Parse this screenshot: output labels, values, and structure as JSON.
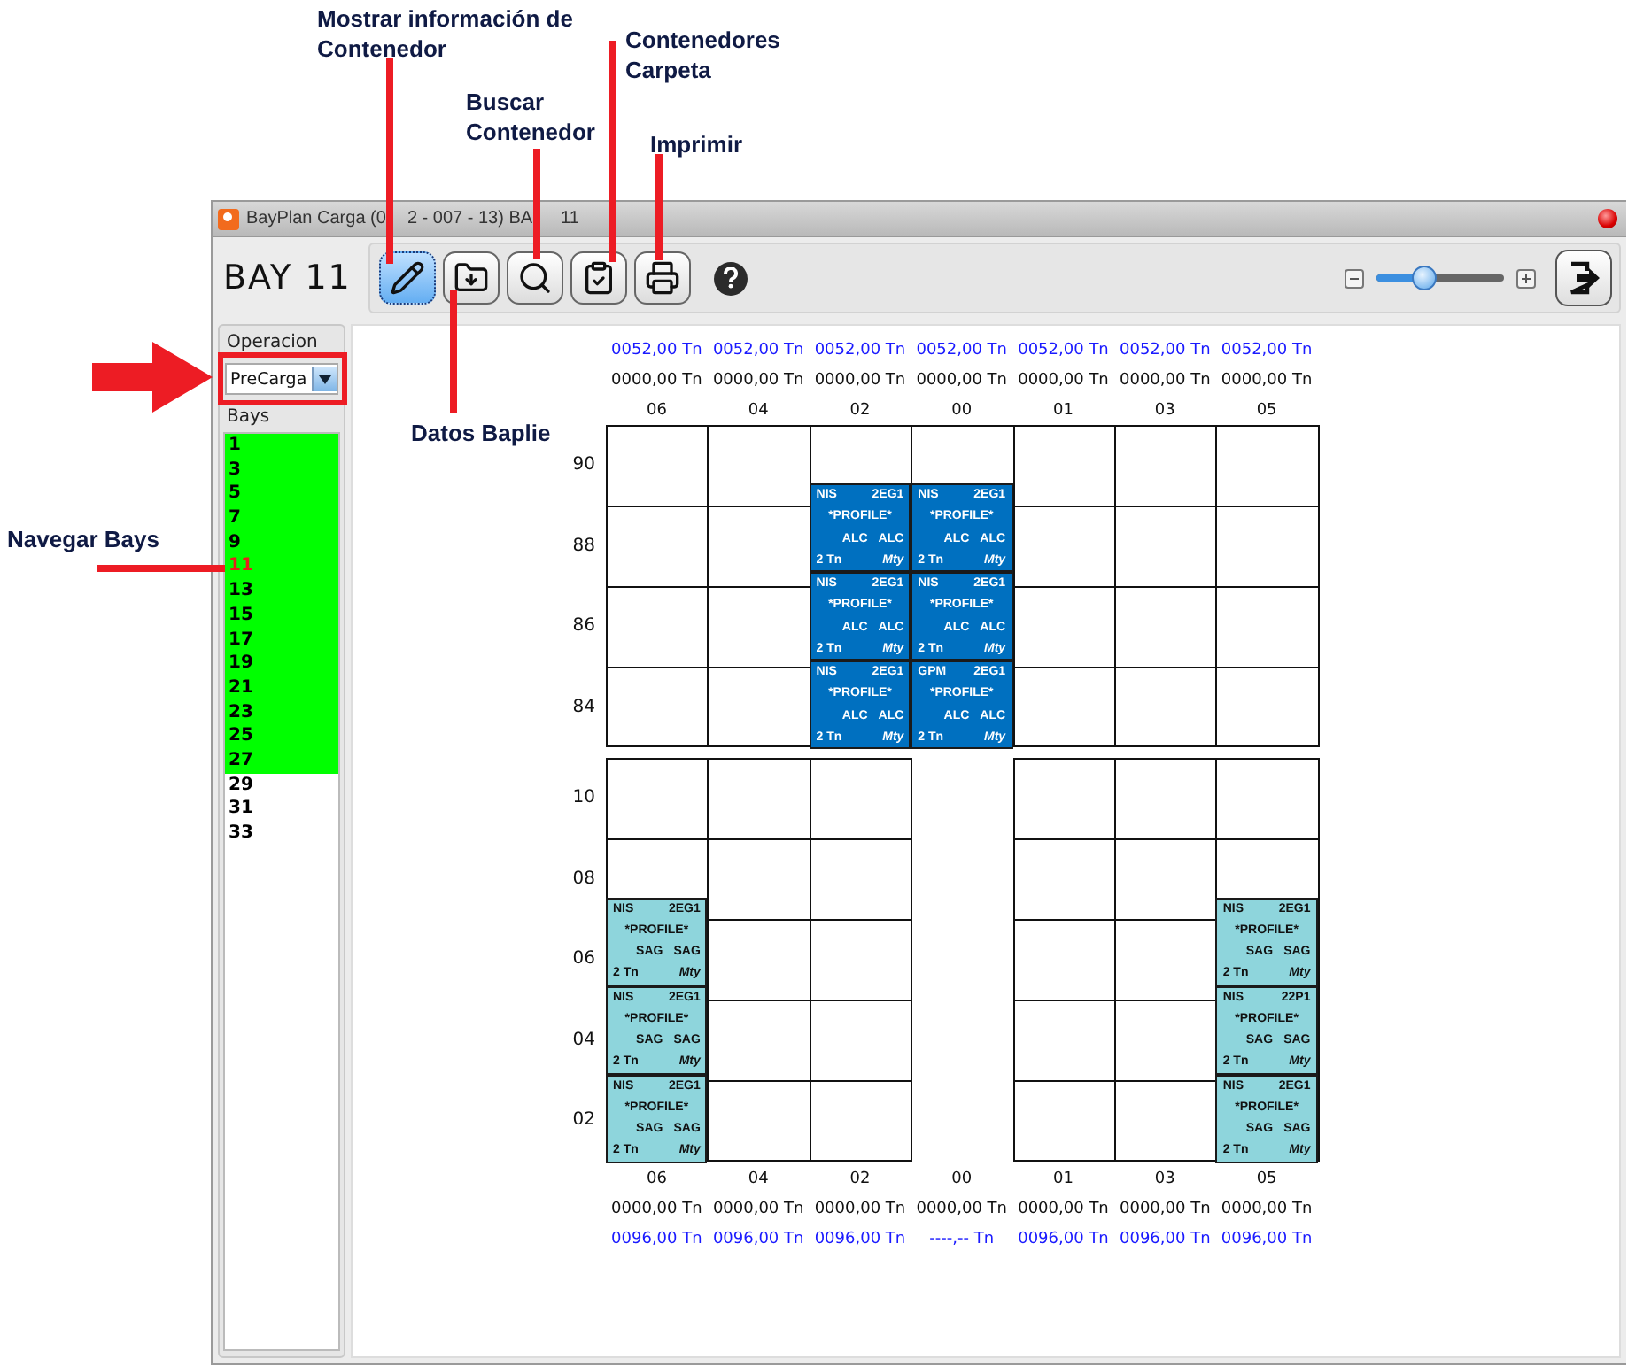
{
  "annotations": [
    {
      "text": "Mostrar información de Contenedor"
    },
    {
      "text": "Buscar Contenedor"
    },
    {
      "text": "Contenedores Carpeta"
    },
    {
      "text": "Imprimir"
    },
    {
      "text": "Datos Baplie"
    },
    {
      "text": "Navegar Bays"
    }
  ],
  "window": {
    "title_segments": [
      "BayPlan Carga (0",
      "2 - 007 - 13) BA",
      "11"
    ]
  },
  "toolbar": {
    "bay_label": "BAY 11",
    "tools": [
      {
        "kind": "pencil",
        "selected": true
      },
      {
        "kind": "download",
        "selected": false
      },
      {
        "kind": "search",
        "selected": false
      },
      {
        "kind": "clipboard",
        "selected": false
      },
      {
        "kind": "printer",
        "selected": false
      },
      {
        "kind": "help",
        "selected": false
      }
    ],
    "zoom": {
      "level": 0.38
    }
  },
  "sidebar": {
    "operation_label": "Operacion",
    "operation_value": "PreCarga",
    "bays_label": "Bays",
    "bays": [
      {
        "label": "1",
        "highlighted": true,
        "selected": false
      },
      {
        "label": "3",
        "highlighted": true,
        "selected": false
      },
      {
        "label": "5",
        "highlighted": true,
        "selected": false
      },
      {
        "label": "7",
        "highlighted": true,
        "selected": false
      },
      {
        "label": "9",
        "highlighted": true,
        "selected": false
      },
      {
        "label": "11",
        "highlighted": true,
        "selected": true
      },
      {
        "label": "13",
        "highlighted": true,
        "selected": false
      },
      {
        "label": "15",
        "highlighted": true,
        "selected": false
      },
      {
        "label": "17",
        "highlighted": true,
        "selected": false
      },
      {
        "label": "19",
        "highlighted": true,
        "selected": false
      },
      {
        "label": "21",
        "highlighted": true,
        "selected": false
      },
      {
        "label": "23",
        "highlighted": true,
        "selected": false
      },
      {
        "label": "25",
        "highlighted": true,
        "selected": false
      },
      {
        "label": "27",
        "highlighted": true,
        "selected": false
      },
      {
        "label": "29",
        "highlighted": false,
        "selected": false
      },
      {
        "label": "31",
        "highlighted": false,
        "selected": false
      },
      {
        "label": "33",
        "highlighted": false,
        "selected": false
      }
    ]
  },
  "plan": {
    "top_columns": [
      {
        "max": "0052,00 Tn",
        "weight": "0000,00 Tn",
        "label": "06"
      },
      {
        "max": "0052,00 Tn",
        "weight": "0000,00 Tn",
        "label": "04"
      },
      {
        "max": "0052,00 Tn",
        "weight": "0000,00 Tn",
        "label": "02"
      },
      {
        "max": "0052,00 Tn",
        "weight": "0000,00 Tn",
        "label": "00"
      },
      {
        "max": "0052,00 Tn",
        "weight": "0000,00 Tn",
        "label": "01"
      },
      {
        "max": "0052,00 Tn",
        "weight": "0000,00 Tn",
        "label": "03"
      },
      {
        "max": "0052,00 Tn",
        "weight": "0000,00 Tn",
        "label": "05"
      }
    ],
    "blocks": [
      {
        "rows": [
          "90",
          "88",
          "86",
          "84"
        ],
        "columns": [
          {
            "kind": "slots"
          },
          {
            "kind": "slots"
          },
          {
            "kind": "slots",
            "stack": [
              {
                "pod": "NIS",
                "iso": "2EG1",
                "tag": "*PROFILE*",
                "ports": [
                  "ALC",
                  "ALC"
                ],
                "weight": "2 Tn",
                "status": "Mty",
                "color": "#0070c0"
              },
              {
                "pod": "NIS",
                "iso": "2EG1",
                "tag": "*PROFILE*",
                "ports": [
                  "ALC",
                  "ALC"
                ],
                "weight": "2 Tn",
                "status": "Mty",
                "color": "#0070c0"
              },
              {
                "pod": "NIS",
                "iso": "2EG1",
                "tag": "*PROFILE*",
                "ports": [
                  "ALC",
                  "ALC"
                ],
                "weight": "2 Tn",
                "status": "Mty",
                "color": "#0070c0"
              }
            ]
          },
          {
            "kind": "slots",
            "stack": [
              {
                "pod": "NIS",
                "iso": "2EG1",
                "tag": "*PROFILE*",
                "ports": [
                  "ALC",
                  "ALC"
                ],
                "weight": "2 Tn",
                "status": "Mty",
                "color": "#0070c0"
              },
              {
                "pod": "NIS",
                "iso": "2EG1",
                "tag": "*PROFILE*",
                "ports": [
                  "ALC",
                  "ALC"
                ],
                "weight": "2 Tn",
                "status": "Mty",
                "color": "#0070c0"
              },
              {
                "pod": "GPM",
                "iso": "2EG1",
                "tag": "*PROFILE*",
                "ports": [
                  "ALC",
                  "ALC"
                ],
                "weight": "2 Tn",
                "status": "Mty",
                "color": "#0070c0"
              }
            ]
          },
          {
            "kind": "slots"
          },
          {
            "kind": "slots"
          },
          {
            "kind": "slots"
          }
        ]
      },
      {
        "rows": [
          "10",
          "08",
          "06",
          "04",
          "02"
        ],
        "columns": [
          {
            "kind": "slots",
            "stack": [
              {
                "pod": "NIS",
                "iso": "2EG1",
                "tag": "*PROFILE*",
                "ports": [
                  "SAG",
                  "SAG"
                ],
                "weight": "2 Tn",
                "status": "Mty",
                "color": "#8ed5dc"
              },
              {
                "pod": "NIS",
                "iso": "2EG1",
                "tag": "*PROFILE*",
                "ports": [
                  "SAG",
                  "SAG"
                ],
                "weight": "2 Tn",
                "status": "Mty",
                "color": "#8ed5dc"
              },
              {
                "pod": "NIS",
                "iso": "2EG1",
                "tag": "*PROFILE*",
                "ports": [
                  "SAG",
                  "SAG"
                ],
                "weight": "2 Tn",
                "status": "Mty",
                "color": "#8ed5dc"
              }
            ]
          },
          {
            "kind": "slots"
          },
          {
            "kind": "slots"
          },
          {
            "kind": "gap"
          },
          {
            "kind": "slots"
          },
          {
            "kind": "slots"
          },
          {
            "kind": "slots",
            "stack": [
              {
                "pod": "NIS",
                "iso": "2EG1",
                "tag": "*PROFILE*",
                "ports": [
                  "SAG",
                  "SAG"
                ],
                "weight": "2 Tn",
                "status": "Mty",
                "color": "#8ed5dc"
              },
              {
                "pod": "NIS",
                "iso": "22P1",
                "tag": "*PROFILE*",
                "ports": [
                  "SAG",
                  "SAG"
                ],
                "weight": "2 Tn",
                "status": "Mty",
                "color": "#8ed5dc"
              },
              {
                "pod": "NIS",
                "iso": "2EG1",
                "tag": "*PROFILE*",
                "ports": [
                  "SAG",
                  "SAG"
                ],
                "weight": "2 Tn",
                "status": "Mty",
                "color": "#8ed5dc"
              }
            ]
          }
        ]
      }
    ],
    "bottom_columns": [
      {
        "label": "06",
        "weight": "0000,00 Tn",
        "max": "0096,00 Tn"
      },
      {
        "label": "04",
        "weight": "0000,00 Tn",
        "max": "0096,00 Tn"
      },
      {
        "label": "02",
        "weight": "0000,00 Tn",
        "max": "0096,00 Tn"
      },
      {
        "label": "00",
        "weight": "0000,00 Tn",
        "max": "----,-- Tn"
      },
      {
        "label": "01",
        "weight": "0000,00 Tn",
        "max": "0096,00 Tn"
      },
      {
        "label": "03",
        "weight": "0000,00 Tn",
        "max": "0096,00 Tn"
      },
      {
        "label": "05",
        "weight": "0000,00 Tn",
        "max": "0096,00 Tn"
      }
    ]
  }
}
